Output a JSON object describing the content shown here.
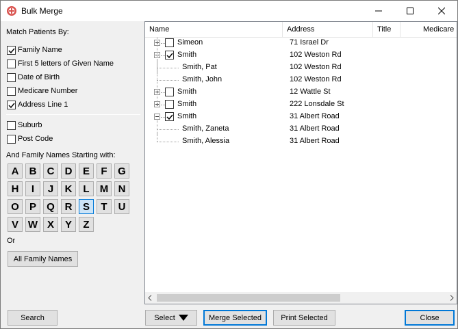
{
  "window": {
    "title": "Bulk Merge",
    "controls": [
      "minimize-icon",
      "maximize-icon",
      "close-icon"
    ]
  },
  "match": {
    "heading": "Match Patients By:",
    "options": [
      {
        "label": "Family Name",
        "checked": true
      },
      {
        "label": "First 5 letters of Given Name",
        "checked": false
      },
      {
        "label": "Date of Birth",
        "checked": false
      },
      {
        "label": "Medicare Number",
        "checked": false
      },
      {
        "label": "Address Line 1",
        "checked": true
      }
    ],
    "extra_options": [
      {
        "label": "Suburb",
        "checked": false
      },
      {
        "label": "Post Code",
        "checked": false
      }
    ]
  },
  "letters": {
    "heading": "And Family Names Starting with:",
    "items": [
      "A",
      "B",
      "C",
      "D",
      "E",
      "F",
      "G",
      "H",
      "I",
      "J",
      "K",
      "L",
      "M",
      "N",
      "O",
      "P",
      "Q",
      "R",
      "S",
      "T",
      "U",
      "V",
      "W",
      "X",
      "Y",
      "Z"
    ],
    "selected": "S",
    "or_text": "Or",
    "all_button": "All Family Names"
  },
  "grid": {
    "columns": [
      "Name",
      "Address",
      "Title",
      "Medicare N"
    ],
    "rows": [
      {
        "name": "Simeon",
        "address": "71 Israel Dr",
        "level": 0,
        "expander": "plus",
        "checked": false
      },
      {
        "name": "Smith",
        "address": "102 Weston Rd",
        "level": 0,
        "expander": "minus",
        "checked": true
      },
      {
        "name": "Smith, Pat",
        "address": "102 Weston Rd",
        "level": 1
      },
      {
        "name": "Smith, John",
        "address": "102 Weston Rd",
        "level": 1
      },
      {
        "name": "Smith",
        "address": "12 Wattle St",
        "level": 0,
        "expander": "plus",
        "checked": false
      },
      {
        "name": "Smith",
        "address": "222 Lonsdale St",
        "level": 0,
        "expander": "plus",
        "checked": false
      },
      {
        "name": "Smith",
        "address": "31 Albert Road",
        "level": 0,
        "expander": "minus",
        "checked": true
      },
      {
        "name": "Smith, Zaneta",
        "address": "31 Albert Road",
        "level": 1
      },
      {
        "name": "Smith, Alessia",
        "address": "31 Albert Road",
        "level": 1
      }
    ]
  },
  "footer": {
    "search": "Search",
    "select": "Select",
    "merge_selected": "Merge Selected",
    "print_selected": "Print Selected",
    "close": "Close"
  },
  "colors": {
    "accent": "#0078d7",
    "window_bg": "#f0f0f0",
    "button_bg": "#e1e1e1",
    "selected_letter_bg": "#cce4f7"
  }
}
